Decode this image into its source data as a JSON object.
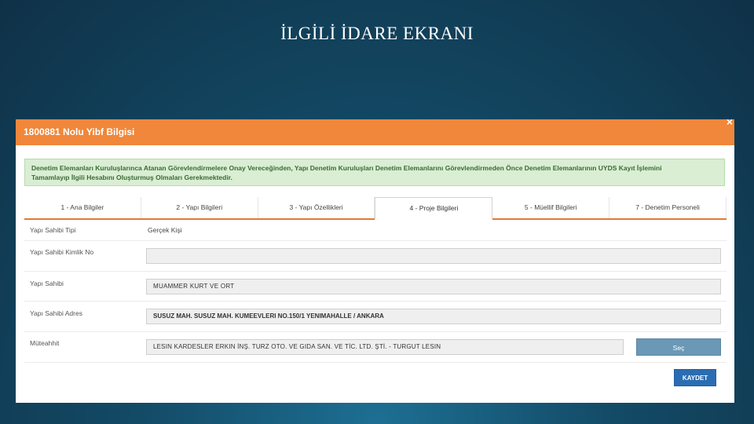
{
  "slide": {
    "title": "İLGİLİ İDARE EKRANI"
  },
  "dialog": {
    "title": "1800881 Nolu Yibf Bilgisi",
    "alert_line1": "Denetim Elemanları Kuruluşlarınca Atanan Görevlendirmelere Onay Vereceğinden, Yapı Denetim Kuruluşları Denetim Elemanlarını Görevlendirmeden Önce Denetim Elemanlarının UYDS Kayıt İşlemini",
    "alert_line2": "Tamamlayıp İlgili Hesabını Oluşturmuş Olmaları Gerekmektedir.",
    "tabs": [
      {
        "label": "1 - Ana Bilgiler"
      },
      {
        "label": "2 - Yapı Bilgileri"
      },
      {
        "label": "3 - Yapı Özellikleri"
      },
      {
        "label": "4 - Proje Bilgileri"
      },
      {
        "label": "5 - Müellif Bilgileri"
      },
      {
        "label": "7 - Denetim Personeli"
      }
    ],
    "active_tab": 3,
    "form": {
      "owner_type_label": "Yapı Sahibi Tipi",
      "owner_type_value": "Gerçek Kişi",
      "owner_id_label": "Yapı Sahibi Kimlik No",
      "owner_id_value": "",
      "owner_label": "Yapı Sahibi",
      "owner_value": "MUAMMER KURT VE ORT",
      "address_label": "Yapı Sahibi Adres",
      "address_value": "SUSUZ MAH. SUSUZ MAH. KUMEEVLERI NO.150/1 YENIMAHALLE / ANKARA",
      "contractor_label": "Müteahhit",
      "contractor_value": "LESIN KARDESLER ERKIN İNŞ. TURZ OTO. VE GIDA SAN. VE TİC. LTD. ŞTİ. - TURGUT LESIN",
      "select_button": "Seç"
    },
    "save_button": "KAYDET"
  }
}
